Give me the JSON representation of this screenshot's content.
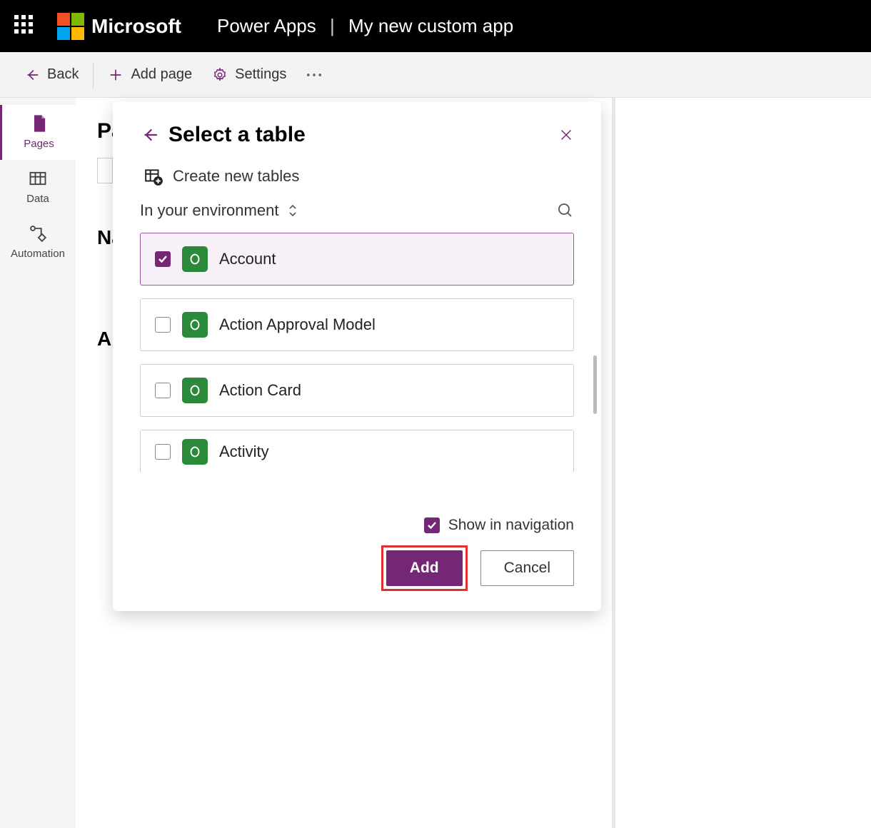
{
  "header": {
    "brand": "Microsoft",
    "product": "Power Apps",
    "app_name": "My new custom app"
  },
  "cmdbar": {
    "back": "Back",
    "add_page": "Add page",
    "settings": "Settings"
  },
  "leftrail": {
    "items": [
      {
        "label": "Pages",
        "icon": "page-icon",
        "active": true
      },
      {
        "label": "Data",
        "icon": "table-icon",
        "active": false
      },
      {
        "label": "Automation",
        "icon": "flow-icon",
        "active": false
      }
    ]
  },
  "main": {
    "heading_partial_1": "Pa",
    "heading_partial_2": "Na",
    "heading_partial_3": "Al"
  },
  "dialog": {
    "title": "Select a table",
    "create_new": "Create new tables",
    "scope_label": "In your environment",
    "tables": [
      {
        "name": "Account",
        "checked": true
      },
      {
        "name": "Action Approval Model",
        "checked": false
      },
      {
        "name": "Action Card",
        "checked": false
      },
      {
        "name": "Activity",
        "checked": false
      }
    ],
    "show_in_nav_label": "Show in navigation",
    "show_in_nav_checked": true,
    "add_label": "Add",
    "cancel_label": "Cancel"
  }
}
